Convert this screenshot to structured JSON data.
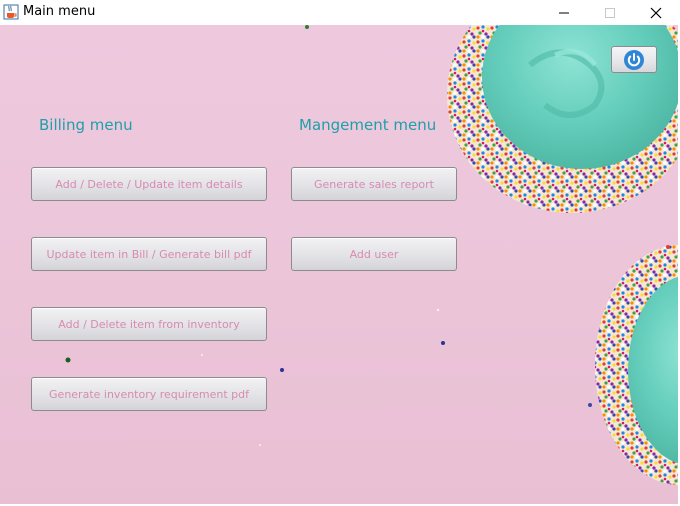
{
  "window": {
    "title": "Main menu",
    "app_icon": "java-cup-icon",
    "controls": [
      "minimize-icon",
      "maximize-icon",
      "close-icon"
    ]
  },
  "billing": {
    "heading": "Billing menu",
    "buttons": [
      "Add / Delete / Update item details",
      "Update item in Bill / Generate bill pdf",
      "Add / Delete item from inventory",
      "Generate inventory requirement pdf"
    ]
  },
  "management": {
    "heading": "Mangement menu",
    "buttons": [
      "Generate sales report",
      "Add user"
    ]
  },
  "power_button": {
    "icon": "power-icon"
  },
  "colors": {
    "background": "#ecc5d9",
    "heading": "#1f9fa8",
    "button_text": "#d88ab0",
    "frosting": "#6fd3c2"
  }
}
